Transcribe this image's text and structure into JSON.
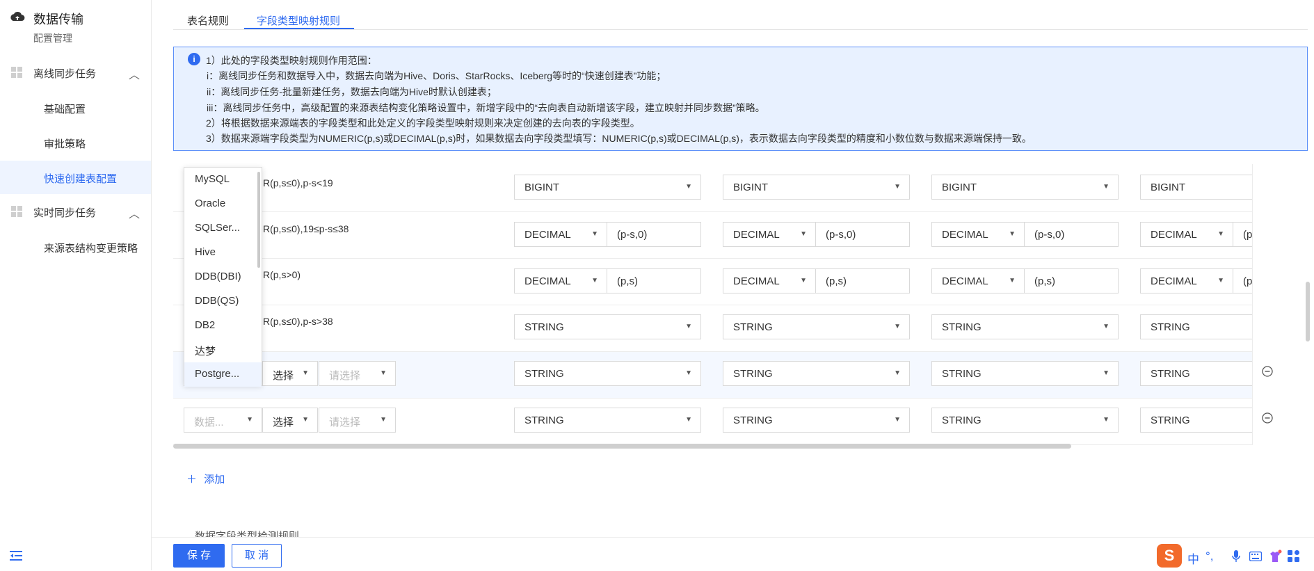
{
  "sidebar": {
    "title": "数据传输",
    "subtitle": "配置管理",
    "groups": [
      {
        "label": "离线同步任务",
        "items": [
          "基础配置",
          "审批策略",
          "快速创建表配置"
        ]
      },
      {
        "label": "实时同步任务",
        "items": [
          "来源表结构变更策略"
        ]
      }
    ]
  },
  "tabs": [
    "表名规则",
    "字段类型映射规则"
  ],
  "notice": {
    "lines": [
      "1）此处的字段类型映射规则作用范围：",
      "i：离线同步任务和数据导入中，数据去向端为Hive、Doris、StarRocks、Iceberg等时的“快速创建表”功能；",
      "ii：离线同步任务-批量新建任务，数据去向端为Hive时默认创建表；",
      "iii：离线同步任务中，高级配置的来源表结构变化策略设置中，新增字段中的“去向表自动新增该字段，建立映射并同步数据”策略。",
      "2）将根据数据来源端表的字段类型和此处定义的字段类型映射规则来决定创建的去向表的字段类型。",
      "3）数据来源端字段类型为NUMERIC(p,s)或DECIMAL(p,s)时，如果数据去向字段类型填写：NUMERIC(p,s)或DECIMAL(p,s)，表示数据去向字段类型的精度和小数位数与数据来源端保持一致。"
    ]
  },
  "rows": [
    {
      "rule": "R(p,s≤0),p-s<19",
      "targets": [
        {
          "type": "BIGINT"
        },
        {
          "type": "BIGINT"
        },
        {
          "type": "BIGINT"
        },
        {
          "type": "BIGINT"
        }
      ]
    },
    {
      "rule": "R(p,s≤0),19≤p-s≤38",
      "targets": [
        {
          "type": "DECIMAL",
          "param": "(p-s,0)"
        },
        {
          "type": "DECIMAL",
          "param": "(p-s,0)"
        },
        {
          "type": "DECIMAL",
          "param": "(p-s,0)"
        },
        {
          "type": "DECIMAL",
          "param": "(p"
        }
      ]
    },
    {
      "rule": "R(p,s>0)",
      "targets": [
        {
          "type": "DECIMAL",
          "param": "(p,s)"
        },
        {
          "type": "DECIMAL",
          "param": "(p,s)"
        },
        {
          "type": "DECIMAL",
          "param": "(p,s)"
        },
        {
          "type": "DECIMAL",
          "param": "(p"
        }
      ]
    },
    {
      "rule": "R(p,s≤0),p-s>38",
      "targets": [
        {
          "type": "STRING"
        },
        {
          "type": "STRING"
        },
        {
          "type": "STRING"
        },
        {
          "type": "STRING"
        }
      ]
    },
    {
      "source": {
        "select": "选择",
        "placeholder": "请选择"
      },
      "targets": [
        {
          "type": "STRING"
        },
        {
          "type": "STRING"
        },
        {
          "type": "STRING"
        },
        {
          "type": "STRING"
        }
      ]
    },
    {
      "source": {
        "db": "数据...",
        "select": "选择",
        "placeholder": "请选择"
      },
      "targets": [
        {
          "type": "STRING"
        },
        {
          "type": "STRING"
        },
        {
          "type": "STRING"
        },
        {
          "type": "STRING"
        }
      ]
    }
  ],
  "dropdown": {
    "options": [
      "MySQL",
      "Oracle",
      "SQLSer...",
      "Hive",
      "DDB(DBI)",
      "DDB(QS)",
      "DB2",
      "达梦",
      "Postgre..."
    ],
    "hovered": 8
  },
  "add_label": "添加",
  "cut_text": "数据字段类型检测规则",
  "footer": {
    "save": "保 存",
    "cancel": "取 消"
  },
  "ime": {
    "items": [
      "中",
      "°,",
      "mic-icon",
      "keyboard-icon",
      "skin-icon",
      "apps-icon"
    ]
  },
  "colors": {
    "accent": "#2f6bf0",
    "notice_bg": "#e8f1ff",
    "notice_border": "#5b8ff9",
    "ime_brand": "#f26a2b"
  }
}
